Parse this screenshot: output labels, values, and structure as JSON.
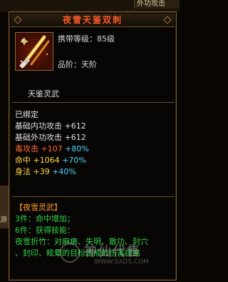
{
  "background": {
    "top_right_label": "外功攻击",
    "left_label": "源"
  },
  "tooltip": {
    "title": "夜雪天鉴双刺",
    "carry_level": "携带等级：85级",
    "grade": "品阶：天阶",
    "item_name": "天鉴灵武",
    "bound": "已绑定",
    "stats": [
      {
        "label": "基础内功攻击",
        "value": "+612",
        "pct": ""
      },
      {
        "label": "基础外功攻击",
        "value": "+612",
        "pct": ""
      },
      {
        "label": "毒攻击",
        "value": "+107",
        "pct": "+80%"
      },
      {
        "label": "命中",
        "value": "+1064",
        "pct": "+70%"
      },
      {
        "label": "身法",
        "value": "+39",
        "pct": "+40%"
      }
    ],
    "set": {
      "title": "【夜雪灵武】",
      "lines": [
        "3件：命中增加；",
        "6件：获得技能：",
        "夜雪折竹：对麻痹、失明、散功、封穴",
        "、封印、眩晕的目标造成的伤害提高"
      ]
    }
  },
  "watermark": {
    "text": "神仙代售",
    "url": "WWW.SXDS.COM"
  },
  "colors": {
    "title": "#ff5a2b",
    "poison": "#ff6a3a",
    "hit": "#ffd94a",
    "pct": "#4ad3ff",
    "set_text": "#2fd14a",
    "set_title": "#ff9a2a"
  },
  "icon": "twin-daggers-icon"
}
